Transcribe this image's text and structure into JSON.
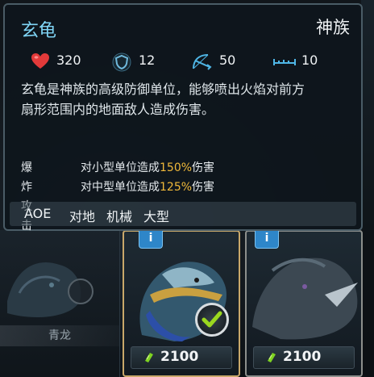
{
  "tooltip": {
    "unit_name": "玄龟",
    "faction": "神族",
    "stats": {
      "health": "320",
      "armor": "12",
      "attack": "50",
      "range": "10"
    },
    "description_line1": "玄龟是神族的高级防御单位，能够喷出火焰对前方",
    "description_line2": "扇形范围内的地面敌人造成伤害。",
    "bonus_label": "爆炸攻击",
    "bonus_small_prefix": "对小型单位造成",
    "bonus_small_pct": "150%",
    "bonus_small_suffix": "伤害",
    "bonus_medium_prefix": "对中型单位造成",
    "bonus_medium_pct": "125%",
    "bonus_medium_suffix": "伤害",
    "tags": [
      "AOE",
      "对地",
      "机械",
      "大型"
    ]
  },
  "cards": {
    "left_card_name": "青龙",
    "card1": {
      "info_label": "i",
      "cost": "2100"
    },
    "card2": {
      "info_label": "i",
      "cost": "2100"
    }
  },
  "icons": {
    "health": "heart-icon",
    "armor": "shield-icon",
    "attack": "bow-icon",
    "range": "ruler-icon",
    "cost": "gem-icon",
    "selected": "checkmark-icon"
  },
  "colors": {
    "title": "#7fd4f5",
    "highlight": "#f0b93a",
    "health": "#e23a3a",
    "accent": "#4fb6e6",
    "check": "#9bd81f"
  }
}
